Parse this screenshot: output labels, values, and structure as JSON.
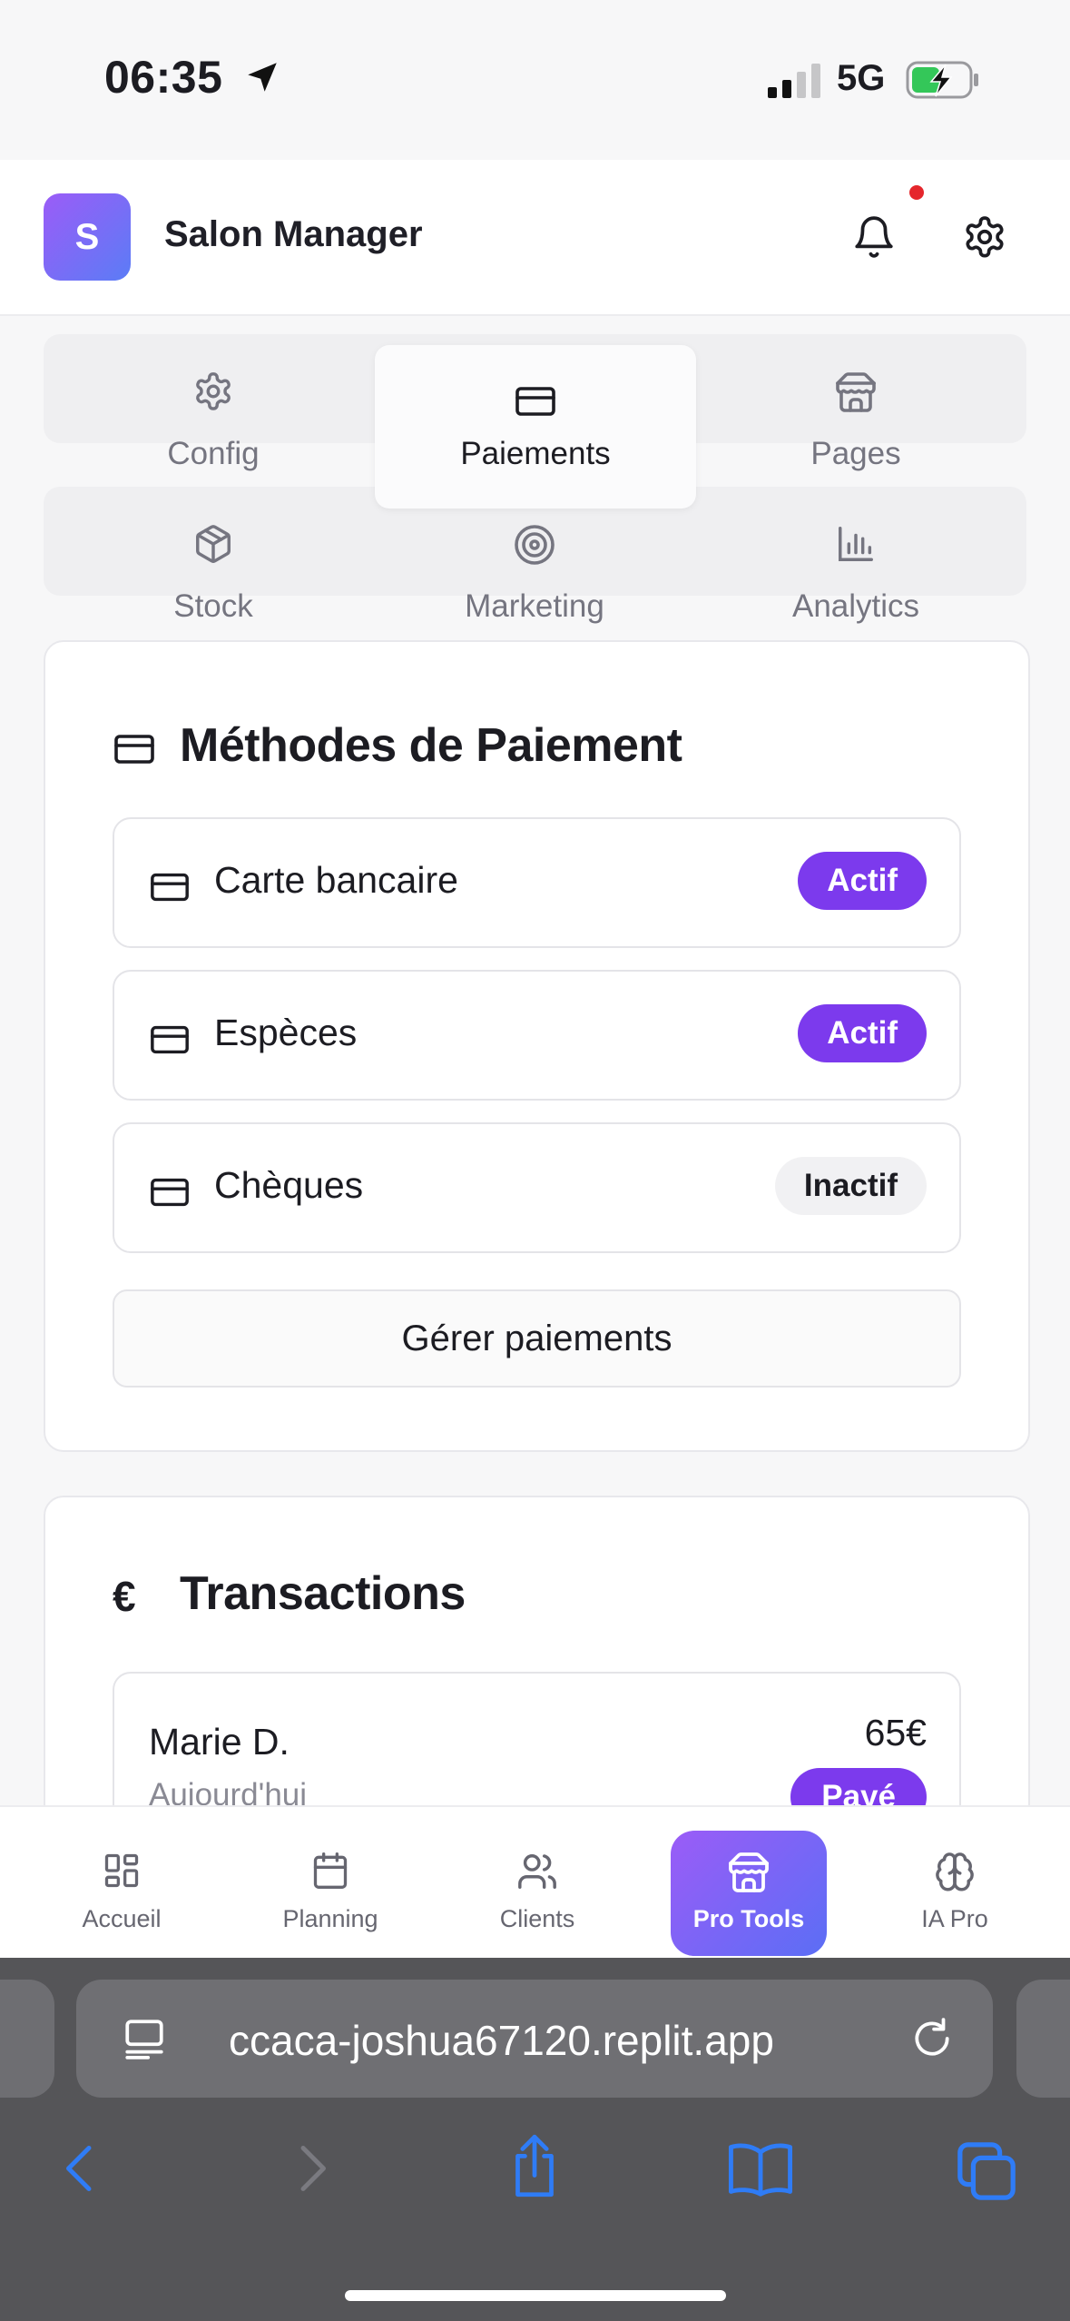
{
  "status_bar": {
    "time": "06:35",
    "network": "5G"
  },
  "header": {
    "logo_letter": "S",
    "title": "Salon Manager",
    "has_notification": true
  },
  "tools_tabs": [
    {
      "label": "Config",
      "icon": "gear-icon",
      "active": false
    },
    {
      "label": "Paiements",
      "icon": "credit-card-icon",
      "active": true
    },
    {
      "label": "Pages",
      "icon": "store-icon",
      "active": false
    },
    {
      "label": "Stock",
      "icon": "package-icon",
      "active": false
    },
    {
      "label": "Marketing",
      "icon": "target-icon",
      "active": false
    },
    {
      "label": "Analytics",
      "icon": "bar-chart-icon",
      "active": false
    }
  ],
  "payment_methods": {
    "title": "Méthodes de Paiement",
    "items": [
      {
        "label": "Carte bancaire",
        "status": "Actif"
      },
      {
        "label": "Espèces",
        "status": "Actif"
      },
      {
        "label": "Chèques",
        "status": "Inactif"
      }
    ],
    "manage_button": "Gérer paiements"
  },
  "transactions": {
    "title": "Transactions",
    "currency_symbol": "€",
    "items": [
      {
        "name": "Marie D.",
        "date": "Aujourd'hui",
        "amount": "65€",
        "status": "Payé"
      }
    ]
  },
  "bottom_nav": [
    {
      "label": "Accueil",
      "icon": "grid-icon",
      "active": false
    },
    {
      "label": "Planning",
      "icon": "calendar-icon",
      "active": false
    },
    {
      "label": "Clients",
      "icon": "users-icon",
      "active": false
    },
    {
      "label": "Pro Tools",
      "icon": "store-icon",
      "active": true
    },
    {
      "label": "IA Pro",
      "icon": "brain-icon",
      "active": false
    }
  ],
  "browser": {
    "url": "ccaca-joshua67120.replit.app"
  },
  "colors": {
    "accent": "#7c3aed",
    "notification": "#e5262c",
    "safari_blue": "#2f7cf6"
  }
}
